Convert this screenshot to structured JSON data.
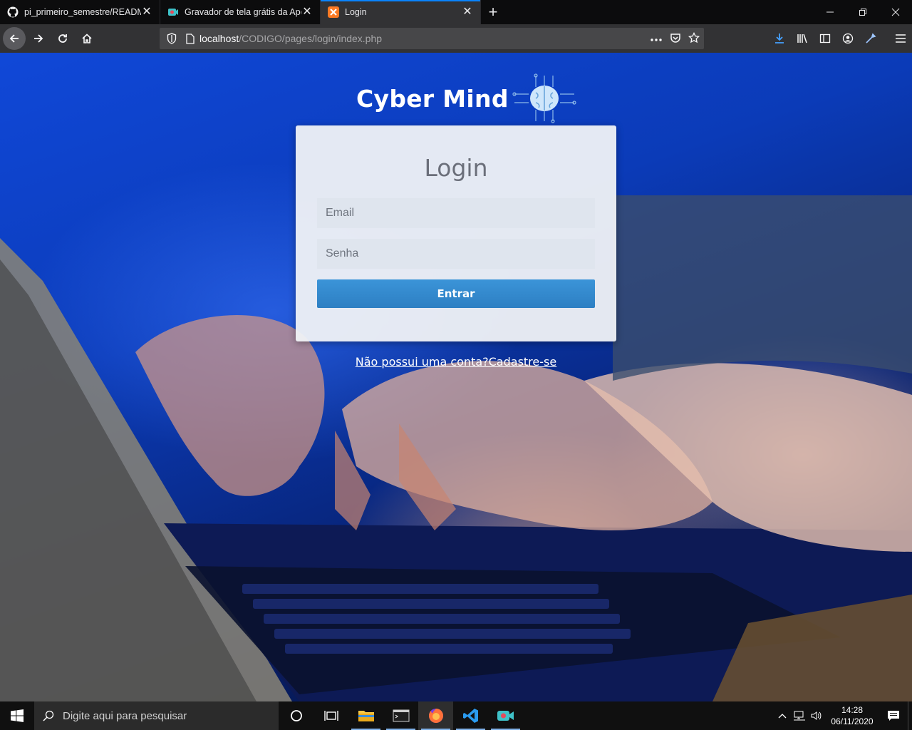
{
  "browser": {
    "tabs": [
      {
        "title": "pi_primeiro_semestre/README.",
        "icon": "github-icon"
      },
      {
        "title": "Gravador de tela grátis da Apow",
        "icon": "recorder-icon"
      },
      {
        "title": "Login",
        "icon": "xampp-icon",
        "active": true
      }
    ],
    "url": {
      "host": "localhost",
      "path": "/CODIGO/pages/login/index.php"
    }
  },
  "page": {
    "brand": "Cyber Mind",
    "login": {
      "title": "Login",
      "email_placeholder": "Email",
      "password_placeholder": "Senha",
      "submit_label": "Entrar"
    },
    "signup_link": "Não possui uma conta?Cadastre-se"
  },
  "taskbar": {
    "search_placeholder": "Digite aqui para pesquisar",
    "apps": [
      "task-view",
      "file-explorer",
      "terminal",
      "firefox",
      "vscode",
      "screen-recorder"
    ],
    "time": "14:28",
    "date": "06/11/2020"
  },
  "colors": {
    "accent_tab": "#0a84ff",
    "button": "#2d7fc3",
    "card": "#f0f2f6"
  }
}
